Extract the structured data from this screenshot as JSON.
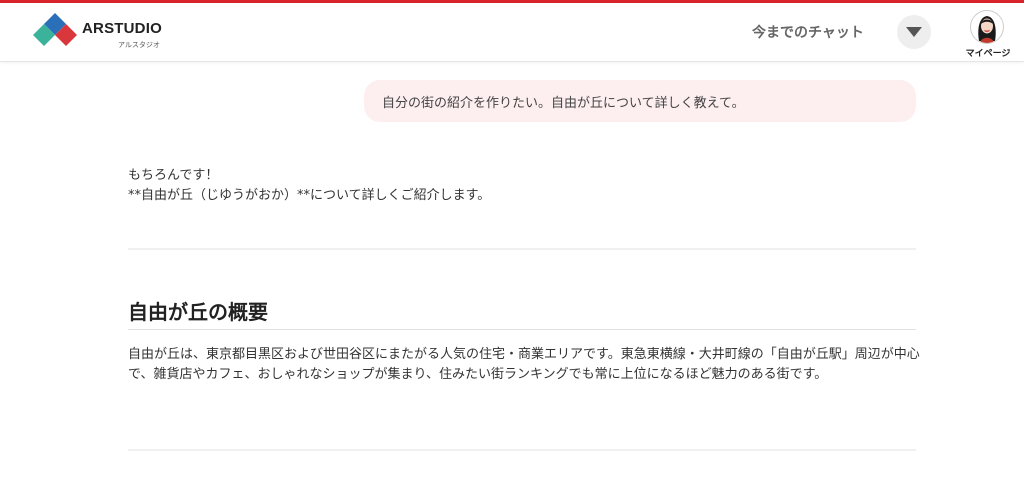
{
  "header": {
    "brand": "ARSTUDIO",
    "brand_sub": "アルスタジオ",
    "history_link": "今までのチャット",
    "mypage_label": "マイページ"
  },
  "colors": {
    "accent_red": "#d8242b",
    "logo_blue": "#2a6fb8",
    "logo_teal": "#3bb39b",
    "logo_red": "#d9373c",
    "user_bubble_bg": "#fdeef0"
  },
  "icons": {
    "dropdown": "triangle-down-icon",
    "avatar": "user-avatar"
  },
  "chat": {
    "user_message": "自分の街の紹介を作りたい。自由が丘について詳しく教えて。",
    "reply_line1": "もちろんです！",
    "reply_line2": "**自由が丘（じゆうがおか）**について詳しくご紹介します。",
    "section_title": "自由が丘の概要",
    "section_body": "自由が丘は、東京都目黒区および世田谷区にまたがる人気の住宅・商業エリアです。東急東横線・大井町線の「自由が丘駅」周辺が中心で、雑貨店やカフェ、おしゃれなショップが集まり、住みたい街ランキングでも常に上位になるほど魅力のある街です。"
  }
}
